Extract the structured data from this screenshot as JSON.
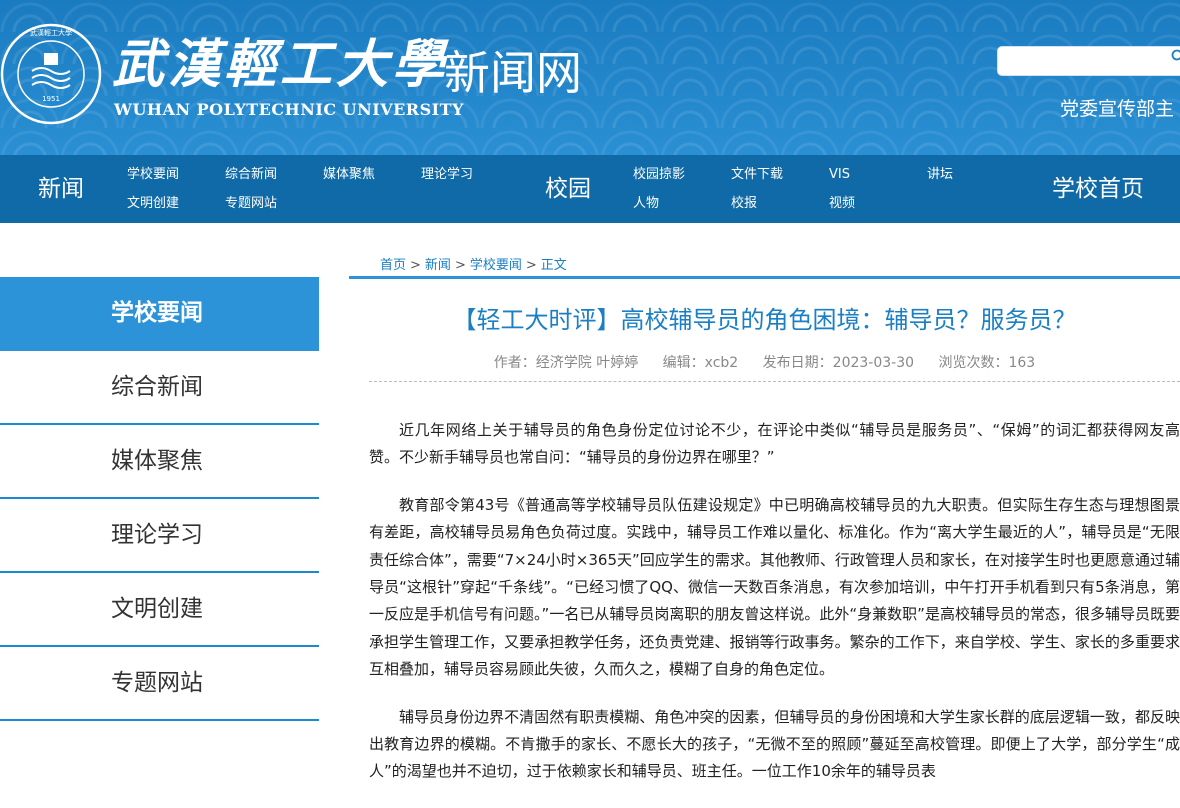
{
  "header": {
    "logo_cn": "武漢輕工大學",
    "logo_site": "新闻网",
    "logo_en": "WUHAN POLYTECHNIC UNIVERSITY",
    "emblem_year": "1951",
    "search_placeholder": "",
    "department": "党委宣传部主"
  },
  "nav": {
    "news_label": "新闻",
    "news_links": [
      "学校要闻",
      "综合新闻",
      "媒体聚焦",
      "理论学习",
      "文明创建",
      "专题网站"
    ],
    "campus_label": "校园",
    "campus_links": [
      "校园掠影",
      "文件下载",
      "VIS",
      "讲坛",
      "人物",
      "校报",
      "视频"
    ],
    "home_label": "学校首页"
  },
  "sidebar": {
    "items": [
      {
        "label": "学校要闻",
        "active": true
      },
      {
        "label": "综合新闻",
        "active": false
      },
      {
        "label": "媒体聚焦",
        "active": false
      },
      {
        "label": "理论学习",
        "active": false
      },
      {
        "label": "文明创建",
        "active": false
      },
      {
        "label": "专题网站",
        "active": false
      }
    ]
  },
  "breadcrumb": {
    "items": [
      "首页",
      "新闻",
      "学校要闻",
      "正文"
    ],
    "separator": ">"
  },
  "article": {
    "title": "【轻工大时评】高校辅导员的角色困境：辅导员？服务员？",
    "author": "作者：经济学院 叶婷婷",
    "editor": "编辑：xcb2",
    "date": "发布日期：2023-03-30",
    "views": "浏览次数：163",
    "paragraphs": [
      "近几年网络上关于辅导员的角色身份定位讨论不少，在评论中类似“辅导员是服务员”、“保姆”的词汇都获得网友高赞。不少新手辅导员也常自问：“辅导员的身份边界在哪里？”",
      "教育部令第43号《普通高等学校辅导员队伍建设规定》中已明确高校辅导员的九大职责。但实际生存生态与理想图景有差距，高校辅导员易角色负荷过度。实践中，辅导员工作难以量化、标准化。作为“离大学生最近的人”，辅导员是“无限责任综合体”，需要“7×24小时×365天”回应学生的需求。其他教师、行政管理人员和家长，在对接学生时也更愿意通过辅导员“这根针”穿起“千条线”。“已经习惯了QQ、微信一天数百条消息，有次参加培训，中午打开手机看到只有5条消息，第一反应是手机信号有问题。”一名已从辅导员岗离职的朋友曾这样说。此外“身兼数职”是高校辅导员的常态，很多辅导员既要承担学生管理工作，又要承担教学任务，还负责党建、报销等行政事务。繁杂的工作下，来自学校、学生、家长的多重要求互相叠加，辅导员容易顾此失彼，久而久之，模糊了自身的角色定位。",
      "辅导员身份边界不清固然有职责模糊、角色冲突的因素，但辅导员的身份困境和大学生家长群的底层逻辑一致，都反映出教育边界的模糊。不肯撒手的家长、不愿长大的孩子，“无微不至的照顾”蔓延至高校管理。即便上了大学，部分学生“成人”的渴望也并不迫切，过于依赖家长和辅导员、班主任。一位工作10余年的辅导员表"
    ]
  },
  "colors": {
    "header_blue": "#1b7fc4",
    "nav_blue": "#0f6aa7",
    "accent_blue": "#2c93d9"
  }
}
